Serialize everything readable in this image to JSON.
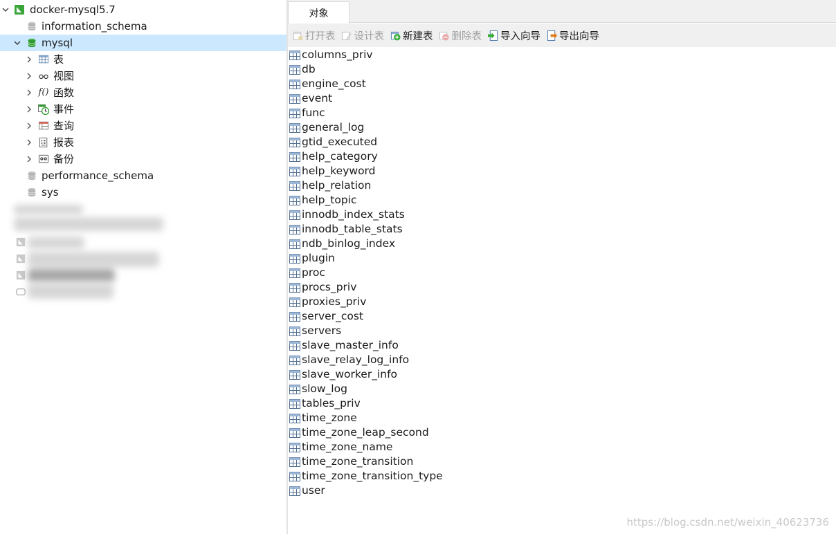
{
  "tree": {
    "connection": "docker-mysql5.7",
    "databases": [
      {
        "name": "information_schema"
      },
      {
        "name": "mysql"
      }
    ],
    "mysql_children": [
      "表",
      "视图",
      "函数",
      "事件",
      "查询",
      "报表",
      "备份"
    ],
    "other_databases": [
      "performance_schema",
      "sys"
    ],
    "function_glyph": "f()"
  },
  "tabs": [
    "对象"
  ],
  "toolbar": {
    "open_table": "打开表",
    "design_table": "设计表",
    "new_table": "新建表",
    "delete_table": "删除表",
    "import_wizard": "导入向导",
    "export_wizard": "导出向导"
  },
  "tables": [
    "columns_priv",
    "db",
    "engine_cost",
    "event",
    "func",
    "general_log",
    "gtid_executed",
    "help_category",
    "help_keyword",
    "help_relation",
    "help_topic",
    "innodb_index_stats",
    "innodb_table_stats",
    "ndb_binlog_index",
    "plugin",
    "proc",
    "procs_priv",
    "proxies_priv",
    "server_cost",
    "servers",
    "slave_master_info",
    "slave_relay_log_info",
    "slave_worker_info",
    "slow_log",
    "tables_priv",
    "time_zone",
    "time_zone_leap_second",
    "time_zone_name",
    "time_zone_transition",
    "time_zone_transition_type",
    "user"
  ],
  "watermark": "https://blog.csdn.net/weixin_40623736",
  "colors": {
    "selection": "#cce8ff",
    "toolbar_bg": "#f0f0f0",
    "green_icon": "#2e9b2e",
    "db_gray": "#b5b5b5"
  }
}
